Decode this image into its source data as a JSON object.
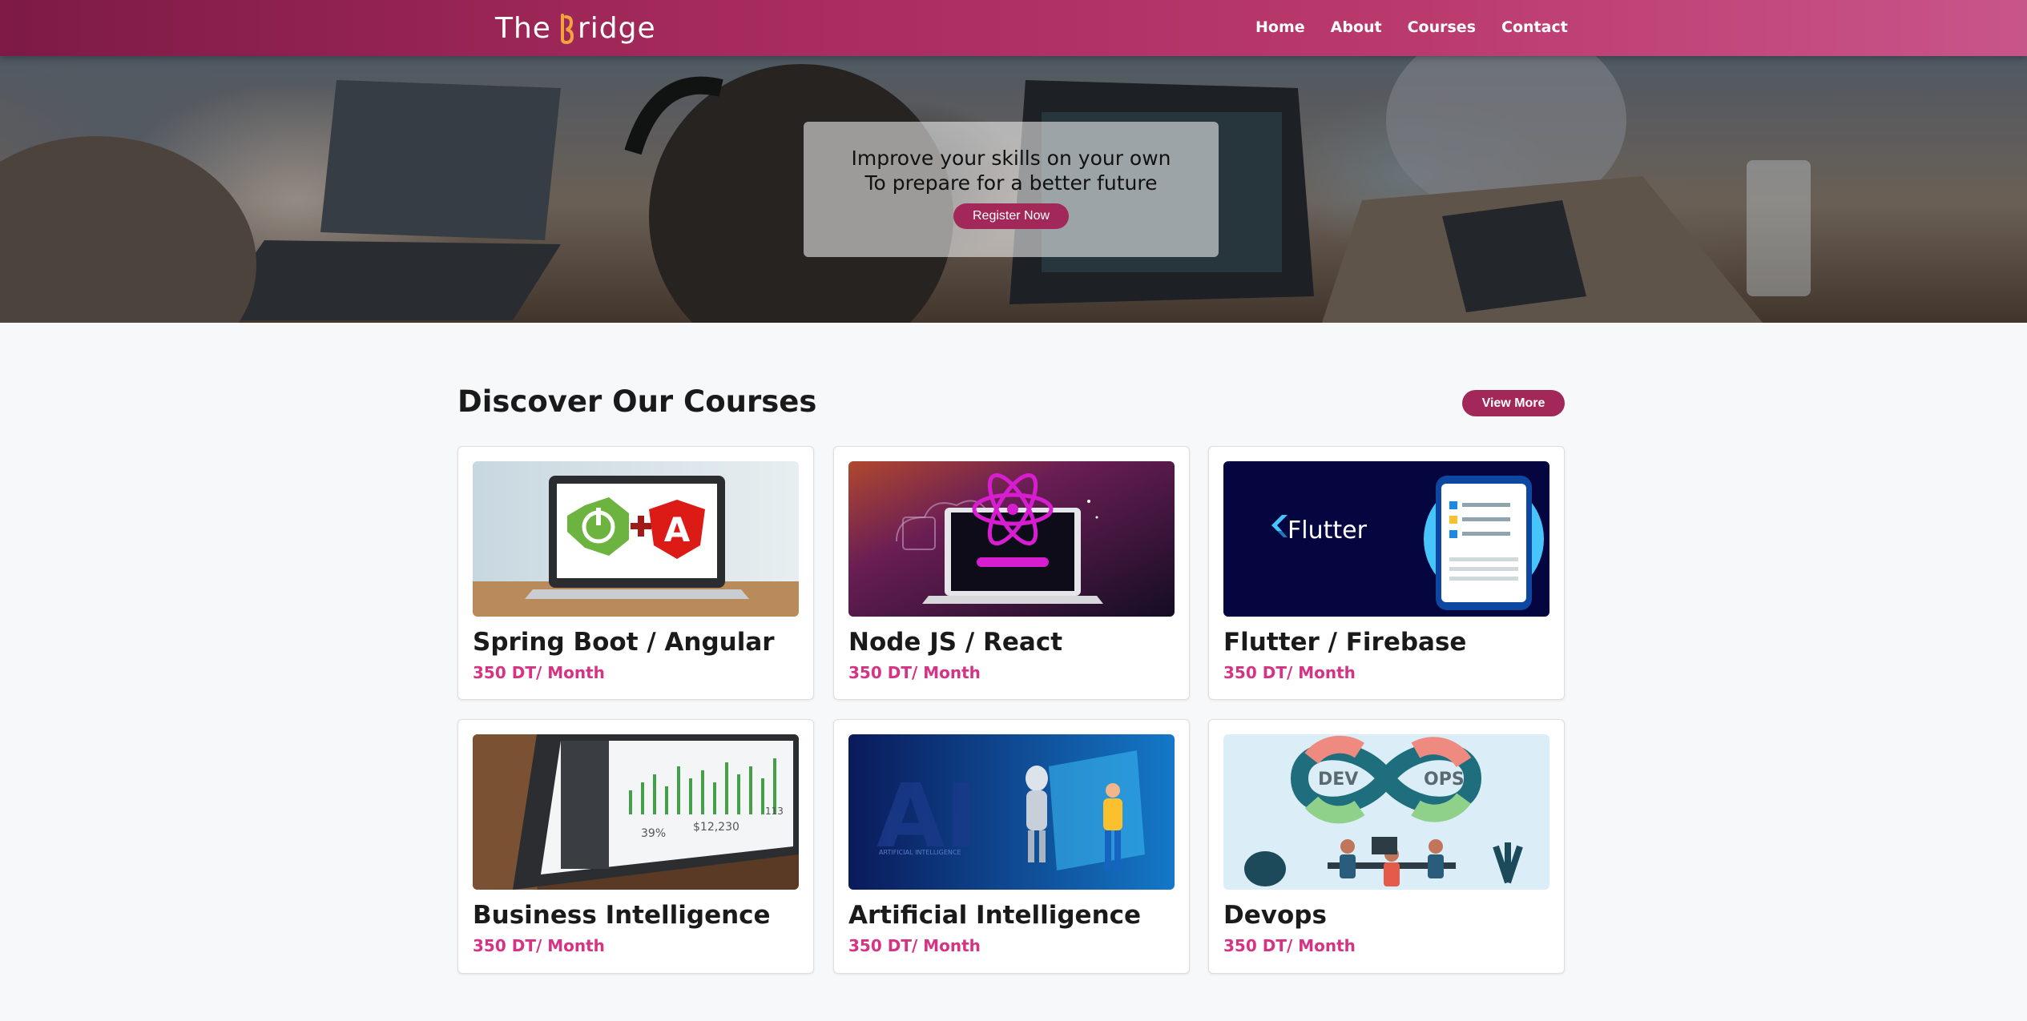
{
  "navbar": {
    "brand_prefix": "The",
    "brand_suffix": "ridge",
    "links": [
      "Home",
      "About",
      "Courses",
      "Contact"
    ]
  },
  "hero": {
    "line1": "Improve your skills on your own",
    "line2": "To prepare for a better future",
    "register_label": "Register Now"
  },
  "courses": {
    "title": "Discover Our Courses",
    "view_more_label": "View More",
    "items": [
      {
        "title": "Spring Boot / Angular",
        "price": "350 DT/ Month"
      },
      {
        "title": "Node JS / React",
        "price": "350 DT/ Month"
      },
      {
        "title": "Flutter / Firebase",
        "price": "350 DT/ Month"
      },
      {
        "title": "Business Intelligence",
        "price": "350 DT/ Month"
      },
      {
        "title": "Artificial Intelligence",
        "price": "350 DT/ Month"
      },
      {
        "title": "Devops",
        "price": "350 DT/ Month"
      }
    ]
  },
  "thumb_text": {
    "flutter": "Flutter",
    "bi_pct": "39%",
    "bi_amount": "$12,230",
    "bi_count": "113",
    "ai": "AI",
    "ai_sub": "ARTIFICIAL INTELLIGENCE",
    "dev": "DEV",
    "ops": "OPS"
  },
  "colors": {
    "brand": "#a3285a",
    "price": "#d63384"
  }
}
